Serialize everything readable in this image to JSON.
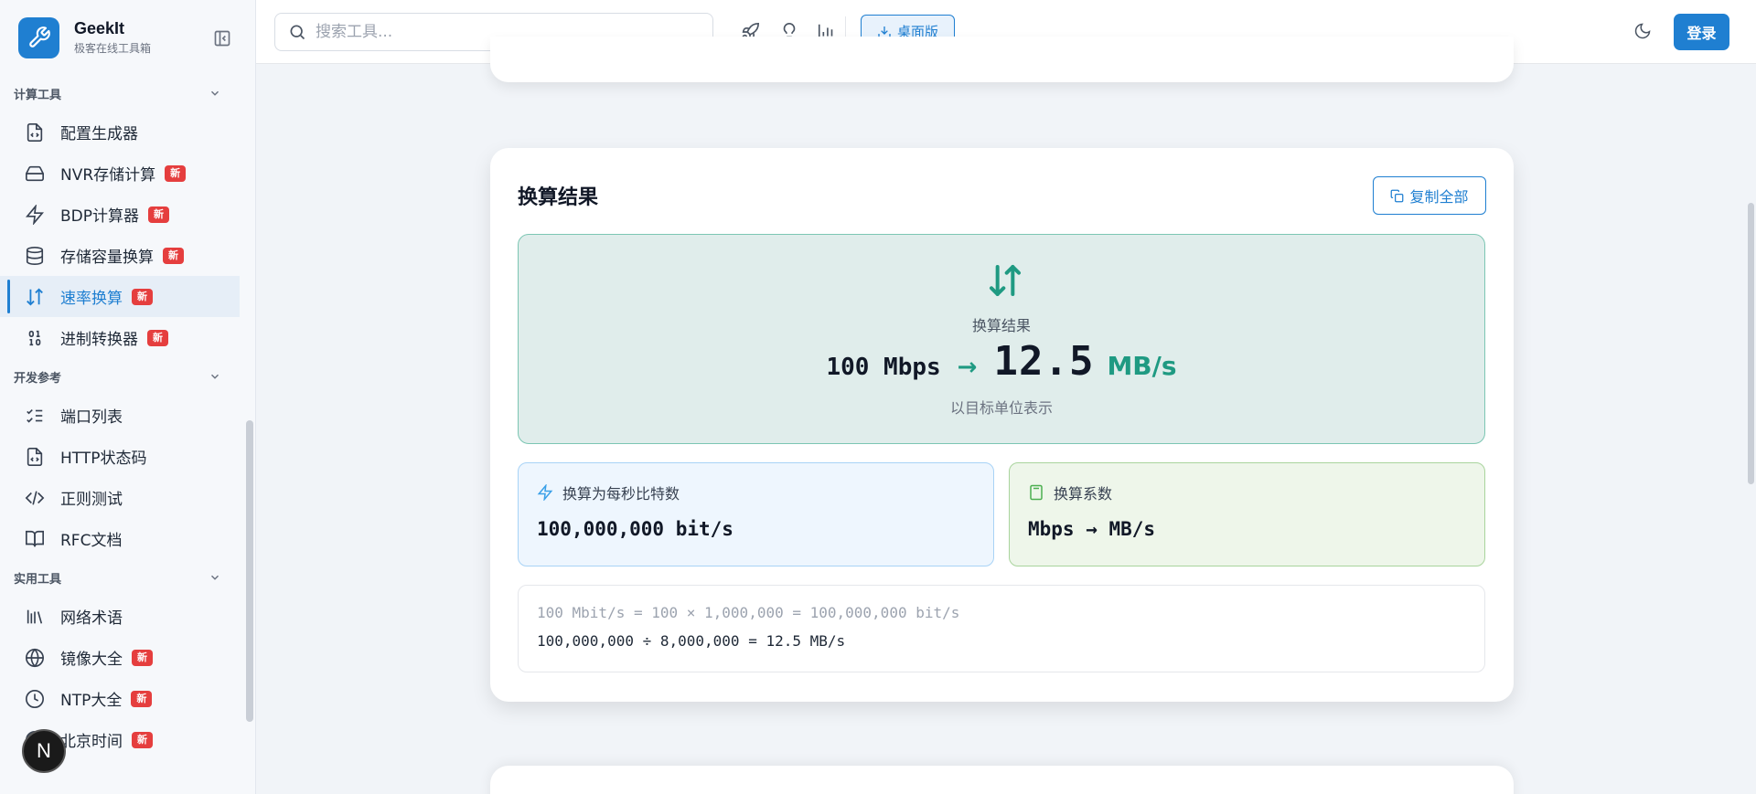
{
  "brand": {
    "name": "GeekIt",
    "subtitle": "极客在线工具箱"
  },
  "search": {
    "placeholder": "搜索工具..."
  },
  "header": {
    "desktop_label": "桌面版",
    "login_label": "登录"
  },
  "sidebar": {
    "sections": [
      {
        "title": "计算工具",
        "items": [
          {
            "label": "配置生成器",
            "icon": "file-code-icon",
            "badge": ""
          },
          {
            "label": "NVR存储计算",
            "icon": "hard-drive-icon",
            "badge": "新"
          },
          {
            "label": "BDP计算器",
            "icon": "zap-icon",
            "badge": "新"
          },
          {
            "label": "存储容量换算",
            "icon": "database-icon",
            "badge": "新"
          },
          {
            "label": "速率换算",
            "icon": "arrow-up-down-icon",
            "badge": "新",
            "active": true
          },
          {
            "label": "进制转换器",
            "icon": "binary-icon",
            "badge": "新"
          }
        ]
      },
      {
        "title": "开发参考",
        "items": [
          {
            "label": "端口列表",
            "icon": "list-checks-icon",
            "badge": ""
          },
          {
            "label": "HTTP状态码",
            "icon": "file-code-icon",
            "badge": ""
          },
          {
            "label": "正则测试",
            "icon": "code-icon",
            "badge": ""
          },
          {
            "label": "RFC文档",
            "icon": "book-open-icon",
            "badge": ""
          }
        ]
      },
      {
        "title": "实用工具",
        "items": [
          {
            "label": "网络术语",
            "icon": "library-icon",
            "badge": ""
          },
          {
            "label": "镜像大全",
            "icon": "globe-icon",
            "badge": "新"
          },
          {
            "label": "NTP大全",
            "icon": "clock-icon",
            "badge": "新"
          },
          {
            "label": "北京时间",
            "icon": "clock-icon",
            "badge": "新"
          }
        ]
      }
    ]
  },
  "floating_button": {
    "label": "N"
  },
  "result_card": {
    "title": "换算结果",
    "copy_all": "复制全部",
    "result_label": "换算结果",
    "from_value": "100 Mbps",
    "to_number": "12.5",
    "to_unit": "MB/s",
    "result_note": "以目标单位表示",
    "bits_box": {
      "title": "换算为每秒比特数",
      "value": "100,000,000 bit/s"
    },
    "factor_box": {
      "title": "换算系数",
      "value": "Mbps → MB/s"
    },
    "formula_line1": "100 Mbit/s = 100 × 1,000,000 = 100,000,000 bit/s",
    "formula_line2": "100,000,000 ÷ 8,000,000 = 12.5 MB/s"
  },
  "colors": {
    "accent": "#1f7fd1",
    "teal": "#1f9a82",
    "badge": "#e53e3e"
  }
}
